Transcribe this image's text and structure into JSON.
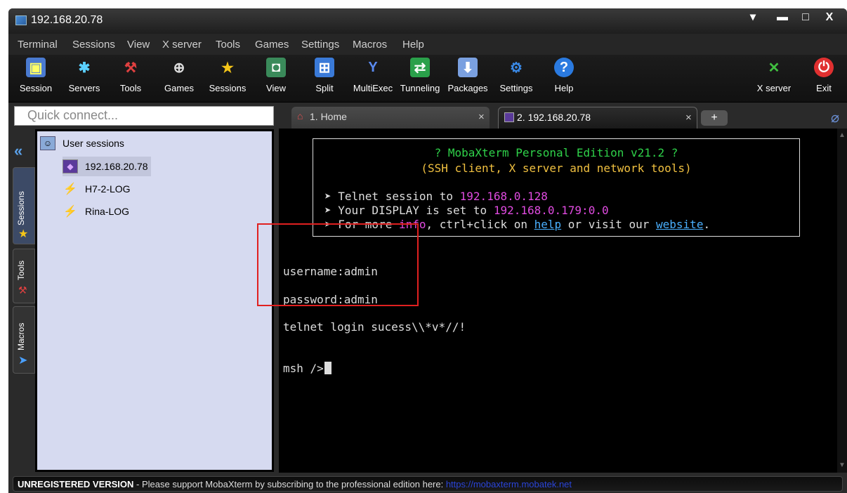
{
  "window": {
    "title": "192.168.20.78"
  },
  "menu": [
    "Terminal",
    "Sessions",
    "View",
    "X server",
    "Tools",
    "Games",
    "Settings",
    "Macros",
    "Help"
  ],
  "toolbar": {
    "session": "Session",
    "servers": "Servers",
    "tools": "Tools",
    "games": "Games",
    "sessions": "Sessions",
    "view": "View",
    "split": "Split",
    "multiexec": "MultiExec",
    "tunneling": "Tunneling",
    "packages": "Packages",
    "settings": "Settings",
    "help": "Help",
    "xserver": "X server",
    "exit": "Exit"
  },
  "quick_connect": {
    "placeholder": "Quick connect..."
  },
  "tabs": [
    {
      "label": "1. Home"
    },
    {
      "label": "2. 192.168.20.78"
    }
  ],
  "sidebar_tabs": {
    "sessions": "Sessions",
    "tools": "Tools",
    "macros": "Macros"
  },
  "sessions": {
    "root": "User sessions",
    "items": [
      "192.168.20.78",
      "H7-2-LOG",
      "Rina-LOG"
    ]
  },
  "terminal": {
    "banner_title": "? MobaXterm Personal Edition v21.2 ?",
    "banner_subtitle": "(SSH client, X server and network tools)",
    "line1_prefix": "➤ Telnet session to ",
    "line1_ip": "192.168.0.128",
    "line2_prefix": "➤ Your DISPLAY is set to ",
    "line2_display": "192.168.0.179:0.0",
    "line3_a": "➤ For more ",
    "line3_info": "info",
    "line3_b": ", ctrl+click on ",
    "line3_help": "help",
    "line3_c": " or visit our ",
    "line3_website": "website",
    "line3_d": ".",
    "username_line": "username:admin",
    "password_line": "password:admin",
    "login_line": "telnet login sucess\\\\*v*//!",
    "prompt": "msh />"
  },
  "status": {
    "unregistered": "UNREGISTERED VERSION",
    "message": " -  Please support MobaXterm by subscribing to the professional edition here: ",
    "url": "https://mobaxterm.mobatek.net"
  },
  "colors": {
    "annotation_box": "#e02020",
    "banner_green": "#2fd24a",
    "banner_yellow": "#f0c040",
    "terminal_magenta": "#e04be0",
    "link_blue": "#4ab0ff"
  }
}
